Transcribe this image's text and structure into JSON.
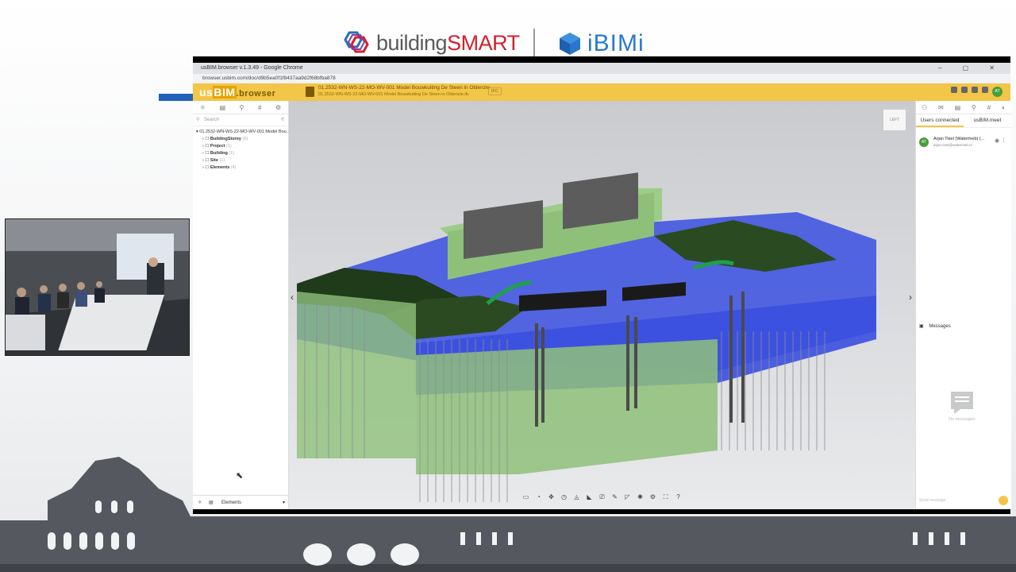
{
  "slide": {
    "logo_building": "building",
    "logo_smart": "SMART",
    "logo_ibimi": "iBIMi"
  },
  "browser": {
    "window_title": "usBIM.browser v.1.3.49 - Google Chrome",
    "url": "browser.usbim.com/doc/d9b5ea0f1f8437aa9d2f68bfba878",
    "window_controls": "– ▢ ✕"
  },
  "app": {
    "brand_us": "us",
    "brand_bim": "BIM",
    "brand_browser": ".browser",
    "doc_title": "01.2532-WN-WS-22-MO-WV-001 Model Bouwkuiting De Steen in Oldenzie",
    "doc_subtitle": "01.2532-WN-WS-22-MO-WV-001 Model Bouwkuiting De Steen in Oldenzie.ifc",
    "doc_badge": "IFC",
    "user_initials": "AT"
  },
  "left_panel": {
    "search_placeholder": "Search",
    "tree_root": "01.2532-WN-WS-22-MO-WV-001 Model Bou...",
    "tree_items": [
      {
        "label": "BuildingStorey",
        "count": "(0)"
      },
      {
        "label": "Project",
        "count": "(1)"
      },
      {
        "label": "Building",
        "count": "(1)"
      },
      {
        "label": "Site",
        "count": "(1)"
      },
      {
        "label": "Elements",
        "count": "(4)"
      }
    ],
    "footer_label": "Elements"
  },
  "viewer": {
    "cube_label": "LEFT"
  },
  "right_panel": {
    "tab_users": "Users connected",
    "tab_meet": "usBIM.meet",
    "user_initials": "AT",
    "user_name": "Arjan Tiset (Watermeb) (...",
    "user_email": "arjan.tiset@watermeb.nl",
    "messages_label": "Messages",
    "no_messages": "No messages",
    "send_placeholder": "Send message"
  },
  "colors": {
    "accent": "#f3c548",
    "water": "#3a4fe0",
    "structure": "#8fc07a",
    "bs_red": "#d2222d",
    "ibimi_blue": "#2a7ad4"
  }
}
